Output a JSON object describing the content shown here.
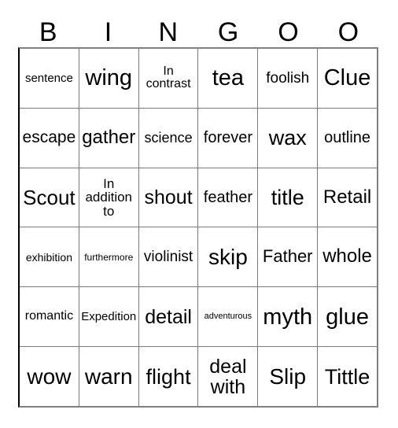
{
  "card": {
    "title": "Bingo Card",
    "columns": 6,
    "rows": 6,
    "header_letters": [
      "B",
      "I",
      "N",
      "G",
      "O",
      "O"
    ],
    "colors": {
      "text": "#000000",
      "background": "#ffffff",
      "grid_line": "#7a7a7a",
      "outer_border": "#808080"
    },
    "cells": [
      [
        {
          "text": "sentence",
          "size": 15
        },
        {
          "text": "wing",
          "size": 29
        },
        {
          "text": "In contrast",
          "size": 16
        },
        {
          "text": "tea",
          "size": 29
        },
        {
          "text": "foolish",
          "size": 19
        },
        {
          "text": "Clue",
          "size": 29
        }
      ],
      [
        {
          "text": "escape",
          "size": 21
        },
        {
          "text": "gather",
          "size": 24
        },
        {
          "text": "science",
          "size": 18
        },
        {
          "text": "forever",
          "size": 20
        },
        {
          "text": "wax",
          "size": 27
        },
        {
          "text": "outline",
          "size": 20
        }
      ],
      [
        {
          "text": "Scout",
          "size": 26
        },
        {
          "text": "In addition to",
          "size": 17
        },
        {
          "text": "shout",
          "size": 25
        },
        {
          "text": "feather",
          "size": 20
        },
        {
          "text": "title",
          "size": 27
        },
        {
          "text": "Retail",
          "size": 24
        }
      ],
      [
        {
          "text": "exhibition",
          "size": 14
        },
        {
          "text": "furthermore",
          "size": 12
        },
        {
          "text": "violinist",
          "size": 19
        },
        {
          "text": "skip",
          "size": 28
        },
        {
          "text": "Father",
          "size": 22
        },
        {
          "text": "whole",
          "size": 24
        }
      ],
      [
        {
          "text": "romantic",
          "size": 16
        },
        {
          "text": "Expedition",
          "size": 15
        },
        {
          "text": "detail",
          "size": 25
        },
        {
          "text": "adventurous",
          "size": 11
        },
        {
          "text": "myth",
          "size": 29
        },
        {
          "text": "glue",
          "size": 29
        }
      ],
      [
        {
          "text": "wow",
          "size": 28
        },
        {
          "text": "warn",
          "size": 28
        },
        {
          "text": "flight",
          "size": 27
        },
        {
          "text": "deal with",
          "size": 25
        },
        {
          "text": "Slip",
          "size": 28
        },
        {
          "text": "Tittle",
          "size": 27
        }
      ]
    ]
  }
}
